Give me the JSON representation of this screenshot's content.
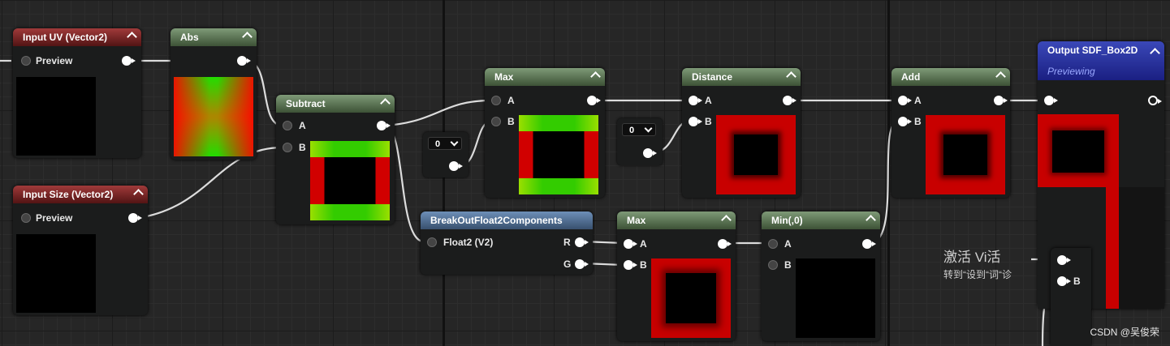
{
  "nodes": {
    "input_uv": {
      "title": "Input UV (Vector2)",
      "pin": "Preview"
    },
    "abs": {
      "title": "Abs"
    },
    "input_size": {
      "title": "Input Size (Vector2)",
      "pin": "Preview"
    },
    "subtract": {
      "title": "Subtract",
      "pin_a": "A",
      "pin_b": "B"
    },
    "const1": {
      "value": "0"
    },
    "max1": {
      "title": "Max",
      "pin_a": "A",
      "pin_b": "B"
    },
    "const2": {
      "value": "0"
    },
    "distance": {
      "title": "Distance",
      "pin_a": "A",
      "pin_b": "B"
    },
    "add": {
      "title": "Add",
      "pin_a": "A",
      "pin_b": "B"
    },
    "output": {
      "title": "Output SDF_Box2D",
      "subtitle": "Previewing"
    },
    "breakout": {
      "title": "BreakOutFloat2Components",
      "input": "Float2 (V2)",
      "out_r": "R",
      "out_g": "G"
    },
    "max2": {
      "title": "Max",
      "pin_a": "A",
      "pin_b": "B"
    },
    "min": {
      "title": "Min(,0)",
      "pin_a": "A",
      "pin_b": "B"
    },
    "partial": {
      "pin_b": "B"
    }
  },
  "watermarks": {
    "activate_title": "激活 Vi活",
    "activate_sub": "转到“设到“词“诊",
    "csdn": "CSDN @吴俊荣"
  }
}
